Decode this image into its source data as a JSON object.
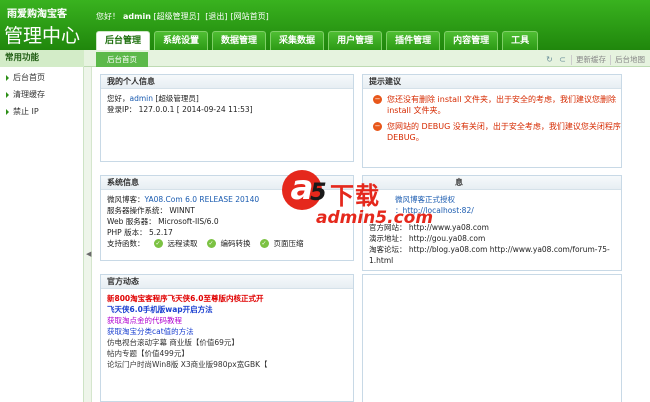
{
  "brand": {
    "top": "雨爱购淘宝客",
    "main": "管理中心"
  },
  "userbar": {
    "greeting": "您好！",
    "username": "admin",
    "role": "[超级管理员]",
    "logout": "[退出]",
    "site_home": "[网站首页]"
  },
  "nav_tabs": [
    {
      "label": "后台管理",
      "active": true
    },
    {
      "label": "系统设置",
      "active": false
    },
    {
      "label": "数据管理",
      "active": false
    },
    {
      "label": "采集数据",
      "active": false
    },
    {
      "label": "用户管理",
      "active": false
    },
    {
      "label": "插件管理",
      "active": false
    },
    {
      "label": "内容管理",
      "active": false
    },
    {
      "label": "工具",
      "active": false
    }
  ],
  "breadcrumb_tab": "后台首页",
  "subtools": {
    "refresh_icon": "refresh-icon",
    "back_icon": "back-icon",
    "clear_cache": "更新缓存",
    "sitemap": "后台地图"
  },
  "sidebar": {
    "title": "常用功能",
    "items": [
      {
        "label": "后台首页"
      },
      {
        "label": "清理缓存"
      },
      {
        "label": "禁止 IP"
      }
    ]
  },
  "my_info": {
    "title": "我的个人信息",
    "hello_prefix": "您好，",
    "username": "admin",
    "role": "[超级管理员]",
    "login_ip": "登录IP： 127.0.0.1 [ 2014-09-24 11:53]"
  },
  "tips": {
    "title": "提示建议",
    "items": [
      {
        "text": "您还没有删除 install 文件夹，出于安全的考虑，我们建议您删除 install 文件夹。"
      },
      {
        "text": "您网站的 DEBUG 没有关闭，出于安全考虑，我们建议您关闭程序 DEBUG。"
      }
    ]
  },
  "sysinfo": {
    "title": "系统信息",
    "version_label": "微风博客：",
    "version_value": "YA08.Com 6.0 RELEASE 20140",
    "os": "服务器操作系统： WINNT",
    "web_server": "Web 服务器： Microsoft-IIS/6.0",
    "php": "PHP 版本： 5.2.17",
    "support_label": "支持函数：",
    "support_items": [
      "远程读取",
      "编码转换",
      "页面压缩"
    ]
  },
  "license": {
    "title_fragment": "息",
    "line1": "微风博客正式授权",
    "line2": "：http://localhost:82/",
    "site_url": "官方网站： http://www.ya08.com",
    "demo_url": "演示地址： http://gou.ya08.com",
    "forum_url": "淘客论坛： http://blog.ya08.com http://www.ya08.com/forum-75-1.html"
  },
  "news": {
    "title": "官方动态",
    "items": [
      {
        "text": "新800淘宝客程序飞天侠6.0至尊版内核正式开",
        "color": "#e00000",
        "bold": true
      },
      {
        "text": "飞天侠6.0手机版wap开启方法",
        "color": "#1a3fd0",
        "bold": true
      },
      {
        "text": "获取淘点金的代码教程",
        "color": "#b000d0",
        "bold": false
      },
      {
        "text": "获取淘宝分类cat值的方法",
        "color": "#1a3fd0",
        "bold": false
      },
      {
        "text": "仿电视台滚动字幕 商业版【价值69元】",
        "color": "#333333",
        "bold": false
      },
      {
        "text": "帖内专题【价值499元】",
        "color": "#333333",
        "bold": false
      },
      {
        "text": "论坛门户时尚Win8版 X3商业版980px宽GBK【",
        "color": "#333333",
        "bold": false
      }
    ]
  },
  "watermark": {
    "letter": "a",
    "digit": "5",
    "text": "下载",
    "url": "admin5.com"
  }
}
